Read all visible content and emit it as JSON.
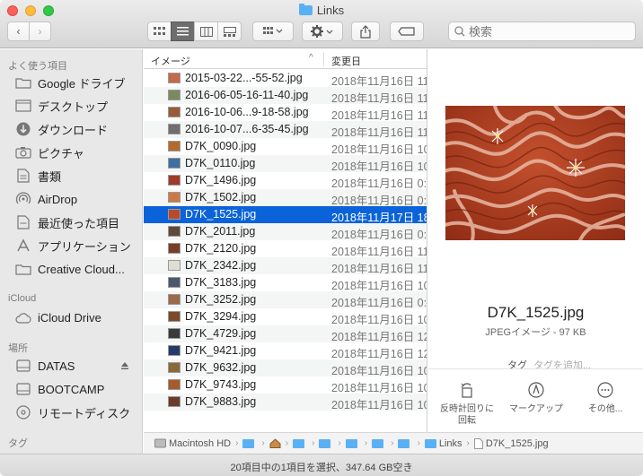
{
  "window": {
    "title": "Links"
  },
  "toolbar": {
    "back_symbol": "‹",
    "forward_symbol": "›",
    "search_placeholder": "検索"
  },
  "sidebar": {
    "favorites_header": "よく使う項目",
    "favorites": [
      {
        "label": "Google ドライブ",
        "icon": "folder-icon"
      },
      {
        "label": "デスクトップ",
        "icon": "desktop-icon"
      },
      {
        "label": "ダウンロード",
        "icon": "download-icon"
      },
      {
        "label": "ピクチャ",
        "icon": "camera-icon"
      },
      {
        "label": "書類",
        "icon": "document-icon"
      },
      {
        "label": "AirDrop",
        "icon": "airdrop-icon"
      },
      {
        "label": "最近使った項目",
        "icon": "recents-icon"
      },
      {
        "label": "アプリケーション",
        "icon": "applications-icon"
      },
      {
        "label": "Creative Cloud...",
        "icon": "folder-icon"
      }
    ],
    "icloud_header": "iCloud",
    "icloud": [
      {
        "label": "iCloud Drive",
        "icon": "cloud-icon"
      }
    ],
    "locations_header": "場所",
    "locations": [
      {
        "label": "DATAS",
        "icon": "disk-icon"
      },
      {
        "label": "BOOTCAMP",
        "icon": "disk-icon"
      },
      {
        "label": "リモートディスク",
        "icon": "remote-disc-icon"
      }
    ],
    "tags_header": "タグ"
  },
  "list": {
    "col_name": "イメージ",
    "col_date": "変更日",
    "sort_indicator": "^",
    "rows": [
      {
        "name": "2015-03-22...-55-52.jpg",
        "date": "2018年11月16日 11:5"
      },
      {
        "name": "2016-06-05-16-11-40.jpg",
        "date": "2018年11月16日 11:5"
      },
      {
        "name": "2016-10-06...9-18-58.jpg",
        "date": "2018年11月16日 11:5"
      },
      {
        "name": "2016-10-07...6-35-45.jpg",
        "date": "2018年11月16日 11:5"
      },
      {
        "name": "D7K_0090.jpg",
        "date": "2018年11月16日 10:"
      },
      {
        "name": "D7K_0110.jpg",
        "date": "2018年11月16日 10:"
      },
      {
        "name": "D7K_1496.jpg",
        "date": "2018年11月16日 0:2"
      },
      {
        "name": "D7K_1502.jpg",
        "date": "2018年11月16日 0:10"
      },
      {
        "name": "D7K_1525.jpg",
        "date": "2018年11月17日 18:"
      },
      {
        "name": "D7K_2011.jpg",
        "date": "2018年11月16日 0:1"
      },
      {
        "name": "D7K_2120.jpg",
        "date": "2018年11月16日 11:"
      },
      {
        "name": "D7K_2342.jpg",
        "date": "2018年11月16日 11:"
      },
      {
        "name": "D7K_3183.jpg",
        "date": "2018年11月16日 10:"
      },
      {
        "name": "D7K_3252.jpg",
        "date": "2018年11月16日 0:2"
      },
      {
        "name": "D7K_3294.jpg",
        "date": "2018年11月16日 10:"
      },
      {
        "name": "D7K_4729.jpg",
        "date": "2018年11月16日 12:"
      },
      {
        "name": "D7K_9421.jpg",
        "date": "2018年11月16日 12:"
      },
      {
        "name": "D7K_9632.jpg",
        "date": "2018年11月16日 10:"
      },
      {
        "name": "D7K_9743.jpg",
        "date": "2018年11月16日 10:"
      },
      {
        "name": "D7K_9883.jpg",
        "date": "2018年11月16日 10:"
      }
    ],
    "selected_index": 8
  },
  "preview": {
    "file_name": "D7K_1525.jpg",
    "kind": "JPEGイメージ - 97 KB",
    "tags_label": "タグ",
    "tags_placeholder": "タグを追加...",
    "actions": [
      {
        "label_line1": "反時計回りに",
        "label_line2": "回転",
        "icon": "rotate-left-icon"
      },
      {
        "label_line1": "マークアップ",
        "label_line2": "",
        "icon": "markup-icon"
      },
      {
        "label_line1": "その他...",
        "label_line2": "",
        "icon": "more-icon"
      }
    ]
  },
  "pathbar": {
    "items": [
      "Macintosh HD",
      "",
      "",
      "",
      "",
      "",
      "",
      "",
      "",
      "",
      "Links",
      "D7K_1525.jpg"
    ]
  },
  "status": {
    "text": "20項目中の1項目を選択、347.64 GB空き"
  },
  "colors": {
    "selection": "#0a63d8",
    "folder_blue": "#5ab0f5",
    "sidebar_bg": "#e8e8e8"
  }
}
